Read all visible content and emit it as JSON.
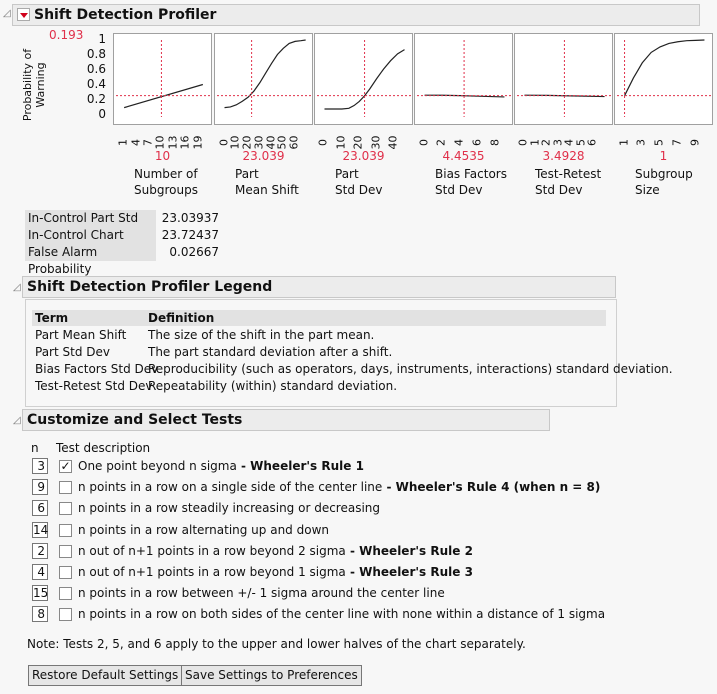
{
  "profiler": {
    "title": "Shift Detection Profiler",
    "y_label_line1": "Probability of",
    "y_label_line2": "Warning",
    "y_value": "0.193",
    "y_ticks": [
      "1",
      "0.8",
      "0.6",
      "0.4",
      "0.2",
      "0"
    ],
    "reference_color": "#e0304a"
  },
  "chart_data": {
    "type": "line",
    "title": "Shift Detection Profiler",
    "ylabel": "Probability of Warning",
    "ylim": [
      0,
      1
    ],
    "current_response": 0.193,
    "panels": [
      {
        "name": "Number of Subgroups",
        "label1": "Number of",
        "label2": "Subgroups",
        "current": "10",
        "current_num": 10,
        "xlim": [
          0,
          21
        ],
        "ticks": [
          "1",
          "4",
          "7",
          "10",
          "13",
          "16",
          "19"
        ],
        "tick_vals": [
          1,
          4,
          7,
          10,
          13,
          16,
          19
        ],
        "x": [
          1,
          20
        ],
        "y": [
          0.02,
          0.355
        ]
      },
      {
        "name": "Part Mean Shift",
        "label1": "Part",
        "label2": "Mean Shift",
        "current": "23.039",
        "current_num": 23.039,
        "xlim": [
          -3,
          71
        ],
        "ticks": [
          "0",
          "10",
          "20",
          "30",
          "40",
          "50",
          "60"
        ],
        "tick_vals": [
          0,
          10,
          20,
          30,
          40,
          50,
          60
        ],
        "x": [
          0,
          5,
          10,
          15,
          20,
          25,
          30,
          35,
          40,
          45,
          50,
          55,
          60,
          65,
          69
        ],
        "y": [
          0.02,
          0.03,
          0.06,
          0.11,
          0.17,
          0.26,
          0.38,
          0.52,
          0.66,
          0.79,
          0.88,
          0.95,
          0.98,
          0.99,
          1.0
        ]
      },
      {
        "name": "Part Std Dev",
        "label1": "Part",
        "label2": "Std Dev",
        "current": "23.039",
        "current_num": 23.039,
        "xlim": [
          -2,
          48
        ],
        "ticks": [
          "0",
          "10",
          "20",
          "30",
          "40"
        ],
        "tick_vals": [
          0,
          10,
          20,
          30,
          40
        ],
        "x": [
          0,
          5,
          10,
          14,
          17,
          20,
          23,
          26,
          30,
          34,
          38,
          42,
          46
        ],
        "y": [
          0.0,
          0.0,
          0.0,
          0.01,
          0.05,
          0.11,
          0.19,
          0.29,
          0.44,
          0.58,
          0.7,
          0.8,
          0.86
        ]
      },
      {
        "name": "Bias Factors Std Dev",
        "label1": "Bias Factors",
        "label2": "Std Dev",
        "current": "4.4535",
        "current_num": 4.4535,
        "xlim": [
          -0.4,
          9.4
        ],
        "ticks": [
          "0",
          "2",
          "4",
          "6",
          "8"
        ],
        "tick_vals": [
          0,
          2,
          4,
          6,
          8
        ],
        "x": [
          0,
          2,
          4,
          6,
          9
        ],
        "y": [
          0.2,
          0.199,
          0.194,
          0.186,
          0.175
        ]
      },
      {
        "name": "Test-Retest Std Dev",
        "label1": "Test-Retest",
        "label2": "Std Dev",
        "current": "3.4928",
        "current_num": 3.4928,
        "xlim": [
          -0.3,
          7.3
        ],
        "ticks": [
          "0",
          "1",
          "2",
          "3",
          "4",
          "5",
          "6"
        ],
        "tick_vals": [
          0,
          1,
          2,
          3,
          4,
          5,
          6
        ],
        "x": [
          0,
          2,
          4,
          7
        ],
        "y": [
          0.2,
          0.197,
          0.19,
          0.18
        ]
      },
      {
        "name": "Subgroup Size",
        "label1": "Subgroup",
        "label2": "Size",
        "current": "1",
        "current_num": 1,
        "xlim": [
          0.6,
          10.4
        ],
        "ticks": [
          "1",
          "3",
          "5",
          "7",
          "9"
        ],
        "tick_vals": [
          1,
          3,
          5,
          7,
          9
        ],
        "x": [
          1,
          2,
          3,
          4,
          5,
          6,
          7,
          8,
          9,
          10
        ],
        "y": [
          0.193,
          0.45,
          0.67,
          0.82,
          0.9,
          0.95,
          0.975,
          0.99,
          0.995,
          1.0
        ]
      }
    ]
  },
  "stats": [
    {
      "label": "In-Control Part Std Dev",
      "value": "23.03937"
    },
    {
      "label": "In-Control Chart Sigma",
      "value": "23.72437"
    },
    {
      "label": "False Alarm Probability",
      "value": "0.02667"
    }
  ],
  "legend": {
    "title": "Shift Detection Profiler Legend",
    "col_term": "Term",
    "col_def": "Definition",
    "rows": [
      {
        "term": "Part Mean Shift",
        "def": "The size of the shift in the part mean."
      },
      {
        "term": "Part Std Dev",
        "def": "The part standard deviation after a shift."
      },
      {
        "term": "Bias Factors Std Dev",
        "def": "Reproducibility (such as operators, days, instruments, interactions) standard deviation."
      },
      {
        "term": "Test-Retest Std Dev",
        "def": "Repeatability (within) standard deviation."
      }
    ]
  },
  "tests": {
    "title": "Customize and Select Tests",
    "col_n": "n",
    "col_desc": "Test description",
    "rows": [
      {
        "n": "3",
        "checked": true,
        "desc": "One point beyond n sigma",
        "rule": " - Wheeler's Rule 1"
      },
      {
        "n": "9",
        "checked": false,
        "desc": "n points in a row on a single side of the center line",
        "rule": " - Wheeler's Rule 4 (when n = 8)"
      },
      {
        "n": "6",
        "checked": false,
        "desc": "n points in a row steadily increasing or decreasing",
        "rule": ""
      },
      {
        "n": "14",
        "checked": false,
        "desc": "n points in a row alternating up and down",
        "rule": ""
      },
      {
        "n": "2",
        "checked": false,
        "desc": "n out of n+1 points in a row beyond 2 sigma",
        "rule": " - Wheeler's Rule 2"
      },
      {
        "n": "4",
        "checked": false,
        "desc": "n out of n+1 points in a row beyond 1 sigma",
        "rule": " - Wheeler's Rule 3"
      },
      {
        "n": "15",
        "checked": false,
        "desc": "n points in a row between +/- 1 sigma around the center line",
        "rule": ""
      },
      {
        "n": "8",
        "checked": false,
        "desc": "n points in a row on both sides of the center line with none within a distance of 1 sigma",
        "rule": ""
      }
    ],
    "note": "Note: Tests 2, 5, and 6 apply to the upper and lower halves of the chart separately.",
    "restore_label": "Restore Default Settings",
    "save_label": "Save Settings to Preferences"
  }
}
